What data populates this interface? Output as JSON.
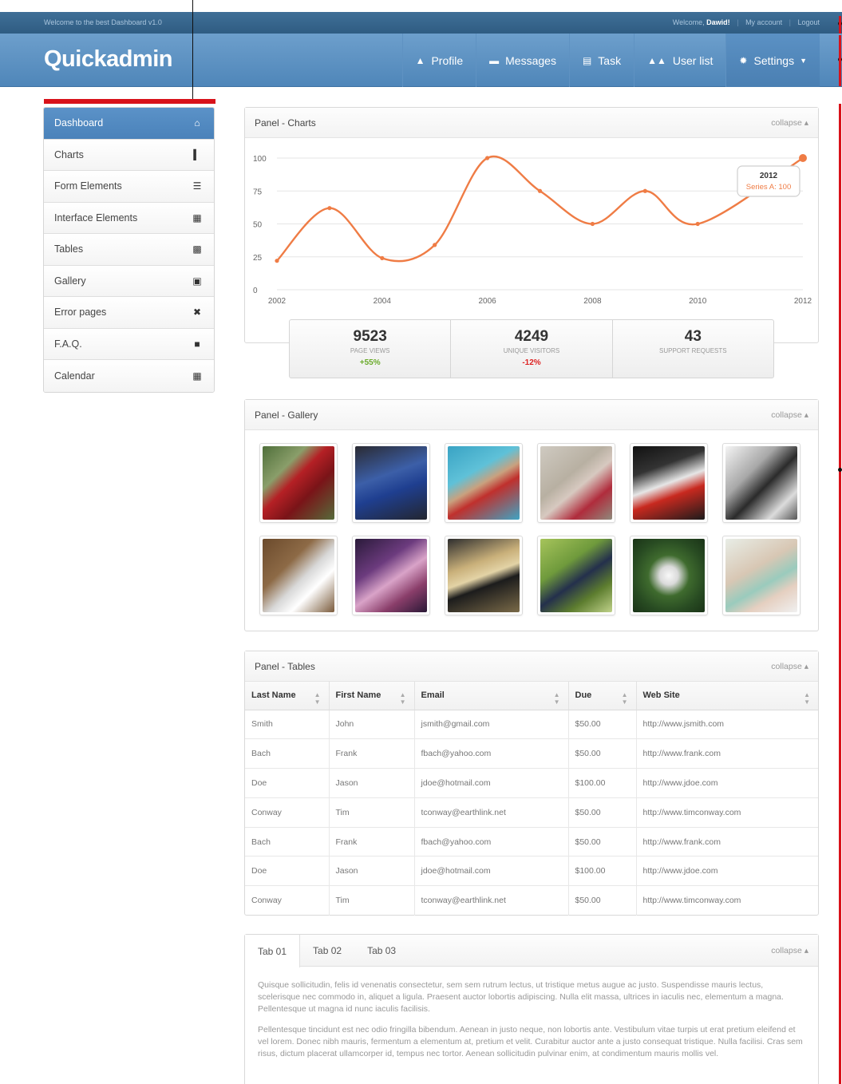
{
  "topbar": {
    "welcome_text": "Welcome to the best Dashboard v1.0",
    "greeting": "Welcome,",
    "user": "Dawid!",
    "my_account": "My account",
    "logout": "Logout",
    "separator": "|"
  },
  "navbar": {
    "brand": "Quickadmin",
    "items": [
      {
        "label": "Profile",
        "icon": "user-icon"
      },
      {
        "label": "Messages",
        "icon": "chat-icon"
      },
      {
        "label": "Task",
        "icon": "document-icon"
      },
      {
        "label": "User list",
        "icon": "users-icon"
      },
      {
        "label": "Settings",
        "icon": "gear-icon"
      }
    ]
  },
  "sidebar": {
    "items": [
      {
        "label": "Dashboard",
        "icon": "home-icon",
        "active": true
      },
      {
        "label": "Charts",
        "icon": "bar-chart-icon"
      },
      {
        "label": "Form Elements",
        "icon": "list-icon"
      },
      {
        "label": "Interface Elements",
        "icon": "calculator-icon"
      },
      {
        "label": "Tables",
        "icon": "grid-icon"
      },
      {
        "label": "Gallery",
        "icon": "picture-icon"
      },
      {
        "label": "Error pages",
        "icon": "close-circle-icon"
      },
      {
        "label": "F.A.Q.",
        "icon": "archive-icon"
      },
      {
        "label": "Calendar",
        "icon": "calendar-icon"
      }
    ]
  },
  "panels": {
    "charts_title": "Panel - Charts",
    "gallery_title": "Panel - Gallery",
    "tables_title": "Panel - Tables",
    "collapse": "collapse"
  },
  "chart_data": {
    "type": "line",
    "x": [
      2002,
      2003,
      2004,
      2005,
      2006,
      2007,
      2008,
      2009,
      2010,
      2012
    ],
    "series": [
      {
        "name": "Series A",
        "values": [
          22,
          62,
          24,
          34,
          100,
          75,
          50,
          75,
          50,
          100
        ],
        "color": "#ef7c45"
      }
    ],
    "xticks": [
      "2002",
      "2004",
      "2006",
      "2008",
      "2010",
      "2012"
    ],
    "yticks": [
      "0",
      "25",
      "50",
      "75",
      "100"
    ],
    "ylim": [
      0,
      100
    ],
    "xlim": [
      2002,
      2012
    ],
    "grid": true,
    "tooltip": {
      "title": "2012",
      "text": "Series A: 100"
    }
  },
  "stats": [
    {
      "value": "9523",
      "label": "PAGE VIEWS",
      "change": "+55%",
      "trend": "up"
    },
    {
      "value": "4249",
      "label": "UNIQUE VISITORS",
      "change": "-12%",
      "trend": "down"
    },
    {
      "value": "43",
      "label": "SUPPORT REQUESTS",
      "change": "",
      "trend": ""
    }
  ],
  "gallery": [
    {
      "name": "red-vintage-car-photo",
      "bg": "linear-gradient(135deg,#4f6f3a 0%,#8a9e6a 30%,#b52025 45%,#7a1418 65%,#566b3a 100%)"
    },
    {
      "name": "blue-sports-car-photo",
      "bg": "linear-gradient(160deg,#2a2a32 0%,#3c5fa8 40%,#1f3f90 60%,#232630 100%)"
    },
    {
      "name": "woman-pool-lounger-photo",
      "bg": "linear-gradient(150deg,#39a3c4 0%,#5fc1d8 35%,#c9a17f 50%,#c0302d 62%,#3fa4c4 100%)"
    },
    {
      "name": "ornament-shoes-photo",
      "bg": "linear-gradient(140deg,#cfcac1 0%,#b8b0a2 40%,#d7c9c0 55%,#b02c3c 75%,#8f8a7c 100%)"
    },
    {
      "name": "race-car-photo",
      "bg": "linear-gradient(160deg,#111 0%,#333 30%,#e6e6e6 50%,#c8291f 65%,#1b1b1b 100%)"
    },
    {
      "name": "sketch-art-photo",
      "bg": "linear-gradient(135deg,#f4f4f4 0%,#a8a8a8 35%,#2b2b2b 55%,#dcdcdc 80%,#555 100%)"
    },
    {
      "name": "wood-phone-photo",
      "bg": "linear-gradient(135deg,#6b4a2c 0%,#8d6a46 35%,#d8d8d8 55%,#ffffff 70%,#7a5a3a 100%)"
    },
    {
      "name": "lit-wall-frames-photo",
      "bg": "linear-gradient(145deg,#2a1a3a 0%,#6c3b7e 35%,#d9a3c8 55%,#8a3e6a 75%,#2a1836 100%)"
    },
    {
      "name": "camaro-car-photo",
      "bg": "linear-gradient(160deg,#2e2e2e 0%,#c9b07a 35%,#e3d3a6 50%,#1c1c1c 62%,#7a6a48 100%)"
    },
    {
      "name": "bird-on-branch-photo",
      "bg": "linear-gradient(145deg,#a6c45b 0%,#6f9a3c 35%,#24304c 55%,#5d7d2f 75%,#c0d28a 100%)"
    },
    {
      "name": "white-flowers-photo",
      "bg": "radial-gradient(circle at 50% 50%,#f8f8f8 0%,#dadada 18%,#3f6b2e 40%,#284b22 70%,#1a3317 100%)"
    },
    {
      "name": "woman-portrait-photo",
      "bg": "linear-gradient(150deg,#e8ede6 0%,#d8c7b4 40%,#9acbbd 60%,#e5cfc0 75%,#f0f0f0 100%)"
    }
  ],
  "table": {
    "headers": [
      "Last Name",
      "First Name",
      "Email",
      "Due",
      "Web Site"
    ],
    "rows": [
      [
        "Smith",
        "John",
        "jsmith@gmail.com",
        "$50.00",
        "http://www.jsmith.com"
      ],
      [
        "Bach",
        "Frank",
        "fbach@yahoo.com",
        "$50.00",
        "http://www.frank.com"
      ],
      [
        "Doe",
        "Jason",
        "jdoe@hotmail.com",
        "$100.00",
        "http://www.jdoe.com"
      ],
      [
        "Conway",
        "Tim",
        "tconway@earthlink.net",
        "$50.00",
        "http://www.timconway.com"
      ],
      [
        "Bach",
        "Frank",
        "fbach@yahoo.com",
        "$50.00",
        "http://www.frank.com"
      ],
      [
        "Doe",
        "Jason",
        "jdoe@hotmail.com",
        "$100.00",
        "http://www.jdoe.com"
      ],
      [
        "Conway",
        "Tim",
        "tconway@earthlink.net",
        "$50.00",
        "http://www.timconway.com"
      ]
    ]
  },
  "tabs": {
    "labels": [
      "Tab 01",
      "Tab 02",
      "Tab 03"
    ],
    "collapse": "collapse",
    "paragraphs": [
      "Quisque sollicitudin, felis id venenatis consectetur, sem sem rutrum lectus, ut tristique metus augue ac justo. Suspendisse mauris lectus, scelerisque nec commodo in, aliquet a ligula. Praesent auctor lobortis adipiscing. Nulla elit massa, ultrices in iaculis nec, elementum a magna. Pellentesque ut magna id nunc iaculis facilisis.",
      "Pellentesque tincidunt est nec odio fringilla bibendum. Aenean in justo neque, non lobortis ante. Vestibulum vitae turpis ut erat pretium eleifend et vel lorem. Donec nibh mauris, fermentum a elementum at, pretium et velit. Curabitur auctor ante a justo consequat tristique. Nulla facilisi. Cras sem risus, dictum placerat ullamcorper id, tempus nec tortor. Aenean sollicitudin pulvinar enim, at condimentum mauris mollis vel."
    ]
  },
  "colors": {
    "accent": "#4f86b9",
    "line": "#ef7c45",
    "annotation_red": "#d8121a",
    "positive": "#6aaa2a",
    "negative": "#dd2222"
  }
}
